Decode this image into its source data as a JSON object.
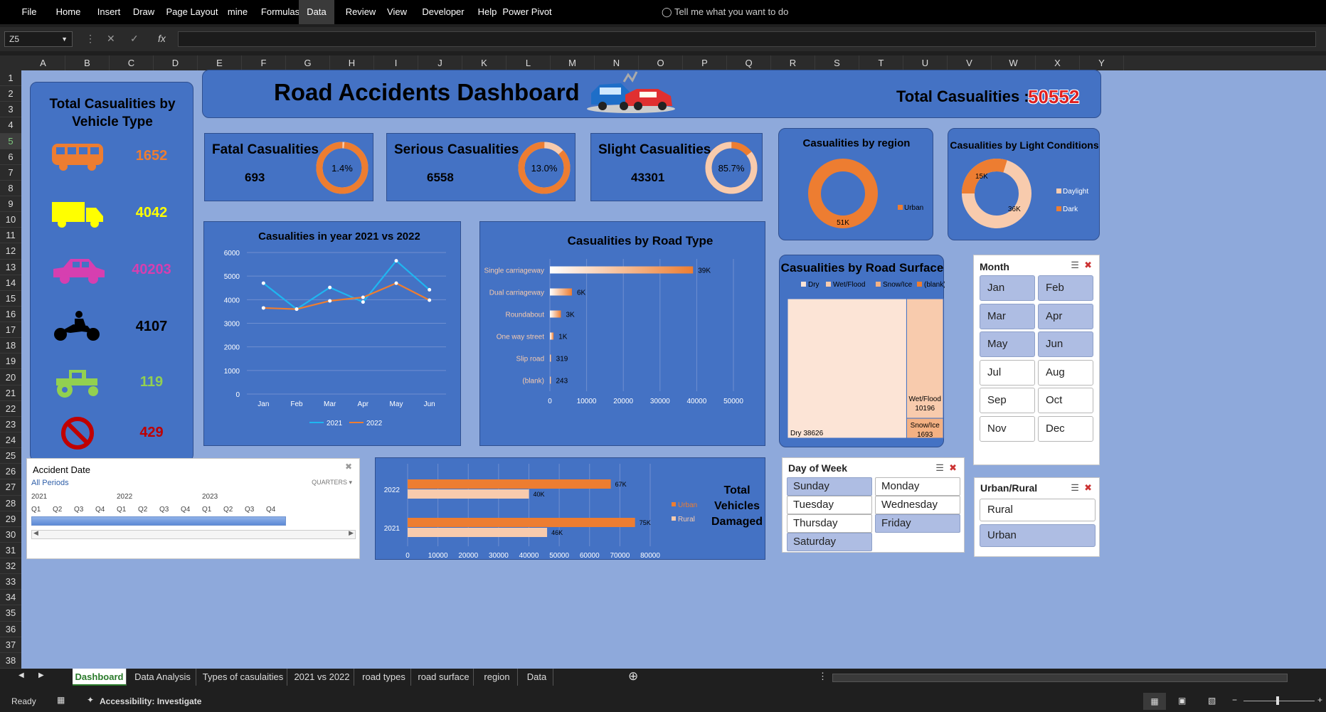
{
  "ribbon": {
    "tabs": [
      "File",
      "Home",
      "Insert",
      "Draw",
      "Page Layout",
      "mine",
      "Formulas",
      "Data",
      "Review",
      "View",
      "Developer",
      "Help",
      "Power Pivot"
    ],
    "active": "Data",
    "tell_me": "Tell me what you want to do"
  },
  "formula_bar": {
    "name_box": "Z5",
    "formula": ""
  },
  "columns": [
    "A",
    "B",
    "C",
    "D",
    "E",
    "F",
    "G",
    "H",
    "I",
    "J",
    "K",
    "L",
    "M",
    "N",
    "O",
    "P",
    "Q",
    "R",
    "S",
    "T",
    "U",
    "V",
    "W",
    "X",
    "Y"
  ],
  "rows": [
    "1",
    "2",
    "3",
    "4",
    "5",
    "6",
    "7",
    "8",
    "9",
    "10",
    "11",
    "12",
    "13",
    "14",
    "15",
    "16",
    "17",
    "18",
    "19",
    "20",
    "21",
    "22",
    "23",
    "24",
    "25",
    "26",
    "27",
    "28",
    "29",
    "30",
    "31",
    "32",
    "33",
    "34",
    "35",
    "36",
    "37",
    "38"
  ],
  "selected_row": "5",
  "vehicle_panel": {
    "title": "Total Casualities by Vehicle Type",
    "items": [
      {
        "icon": "bus-icon",
        "value": "1652",
        "color": "#ed7d31"
      },
      {
        "icon": "truck-icon",
        "value": "4042",
        "color": "#ffff00"
      },
      {
        "icon": "car-icon",
        "value": "40203",
        "color": "#d63fb0"
      },
      {
        "icon": "motorcycle-icon",
        "value": "4107",
        "color": "#000000"
      },
      {
        "icon": "tractor-icon",
        "value": "119",
        "color": "#92d050"
      },
      {
        "icon": "no-entry-icon",
        "value": "429",
        "color": "#c00000"
      }
    ]
  },
  "header": {
    "title": "Road Accidents Dashboard",
    "total_label": "Total Casualities :",
    "total_value": "50552"
  },
  "kpis": [
    {
      "label": "Fatal Casualities",
      "value": "693",
      "pct": "1.4%",
      "fraction": 0.014
    },
    {
      "label": "Serious Casualities",
      "value": "6558",
      "pct": "13.0%",
      "fraction": 0.13
    },
    {
      "label": "Slight Casualities",
      "value": "43301",
      "pct": "85.7%",
      "fraction": 0.857
    }
  ],
  "region_card": {
    "title": "Casualities by region",
    "legend": "Urban",
    "label": "51K"
  },
  "light_card": {
    "title": "Casualities by Light Conditions",
    "legend": [
      "Daylight",
      "Dark"
    ],
    "labels": [
      "15K",
      "36K"
    ]
  },
  "chart_data": [
    {
      "type": "line",
      "title": "Casualities in year 2021 vs 2022",
      "categories": [
        "Jan",
        "Feb",
        "Mar",
        "Apr",
        "May",
        "Jun"
      ],
      "series": [
        {
          "name": "2021",
          "values": [
            4700,
            3600,
            4520,
            3900,
            5650,
            4420
          ],
          "color": "#1fb6f0"
        },
        {
          "name": "2022",
          "values": [
            3650,
            3600,
            3950,
            4100,
            4700,
            3980
          ],
          "color": "#ed7d31"
        }
      ],
      "ylim": [
        0,
        6000
      ],
      "yticks": [
        "0",
        "1000",
        "2000",
        "3000",
        "4000",
        "5000",
        "6000"
      ]
    },
    {
      "type": "bar",
      "title": "Casualities by Road Type",
      "categories": [
        "Single carriageway",
        "Dual carriageway",
        "Roundabout",
        "One way street",
        "Slip road",
        "(blank)"
      ],
      "values": [
        39000,
        6000,
        3000,
        1000,
        319,
        243
      ],
      "labels": [
        "39K",
        "6K",
        "3K",
        "1K",
        "319",
        "243"
      ],
      "xlim": [
        0,
        50000
      ],
      "xticks": [
        "0",
        "10000",
        "20000",
        "30000",
        "40000",
        "50000"
      ]
    },
    {
      "type": "treemap",
      "title": "Casualities by Road Surface",
      "legend": [
        "Dry",
        "Wet/Flood",
        "Snow/Ice",
        "(blank)"
      ],
      "values": [
        38626,
        10196,
        1693
      ],
      "labels": [
        "Dry 38626",
        "Wet/Flood",
        "10196",
        "Snow/Ice",
        "1693"
      ]
    },
    {
      "type": "bar",
      "title": "Total Vehicles Damaged",
      "categories": [
        "2022",
        "2021"
      ],
      "series": [
        {
          "name": "Urban",
          "values": [
            67000,
            75000
          ],
          "labels": [
            "67K",
            "75K"
          ],
          "color": "#ed7d31"
        },
        {
          "name": "Rural",
          "values": [
            40000,
            46000
          ],
          "labels": [
            "40K",
            "46K"
          ],
          "color": "#f8cbad"
        }
      ],
      "xlim": [
        0,
        80000
      ],
      "xticks": [
        "0",
        "10000",
        "20000",
        "30000",
        "40000",
        "50000",
        "60000",
        "70000",
        "80000"
      ],
      "title_lines": [
        "Total",
        "Vehicles",
        "Damaged"
      ]
    }
  ],
  "month_slicer": {
    "title": "Month",
    "items": [
      "Jan",
      "Feb",
      "Mar",
      "Apr",
      "May",
      "Jun",
      "Jul",
      "Aug",
      "Sep",
      "Oct",
      "Nov",
      "Dec"
    ],
    "selected": 6
  },
  "accident_date": {
    "title": "Accident Date",
    "period": "All Periods",
    "level": "QUARTERS",
    "years": [
      "2021",
      "2022",
      "2023"
    ],
    "quarters": [
      "Q1",
      "Q2",
      "Q3",
      "Q4",
      "Q1",
      "Q2",
      "Q3",
      "Q4",
      "Q1",
      "Q2",
      "Q3",
      "Q4"
    ]
  },
  "day_slicer": {
    "title": "Day of Week",
    "items": [
      "Sunday",
      "Monday",
      "Tuesday",
      "Wednesday",
      "Thursday",
      "Friday",
      "Saturday"
    ],
    "selected": [
      "Sunday",
      "Friday",
      "Saturday"
    ]
  },
  "urban_slicer": {
    "title": "Urban/Rural",
    "items": [
      "Rural",
      "Urban"
    ],
    "selected": [
      "Urban"
    ]
  },
  "sheet_tabs": [
    "Dashboard",
    "Data Analysis",
    "Types of casulaities",
    "2021 vs 2022",
    "road types",
    "road surface",
    "region",
    "Data"
  ],
  "active_tab": "Dashboard",
  "status": {
    "ready": "Ready",
    "accessibility": "Accessibility: Investigate"
  }
}
